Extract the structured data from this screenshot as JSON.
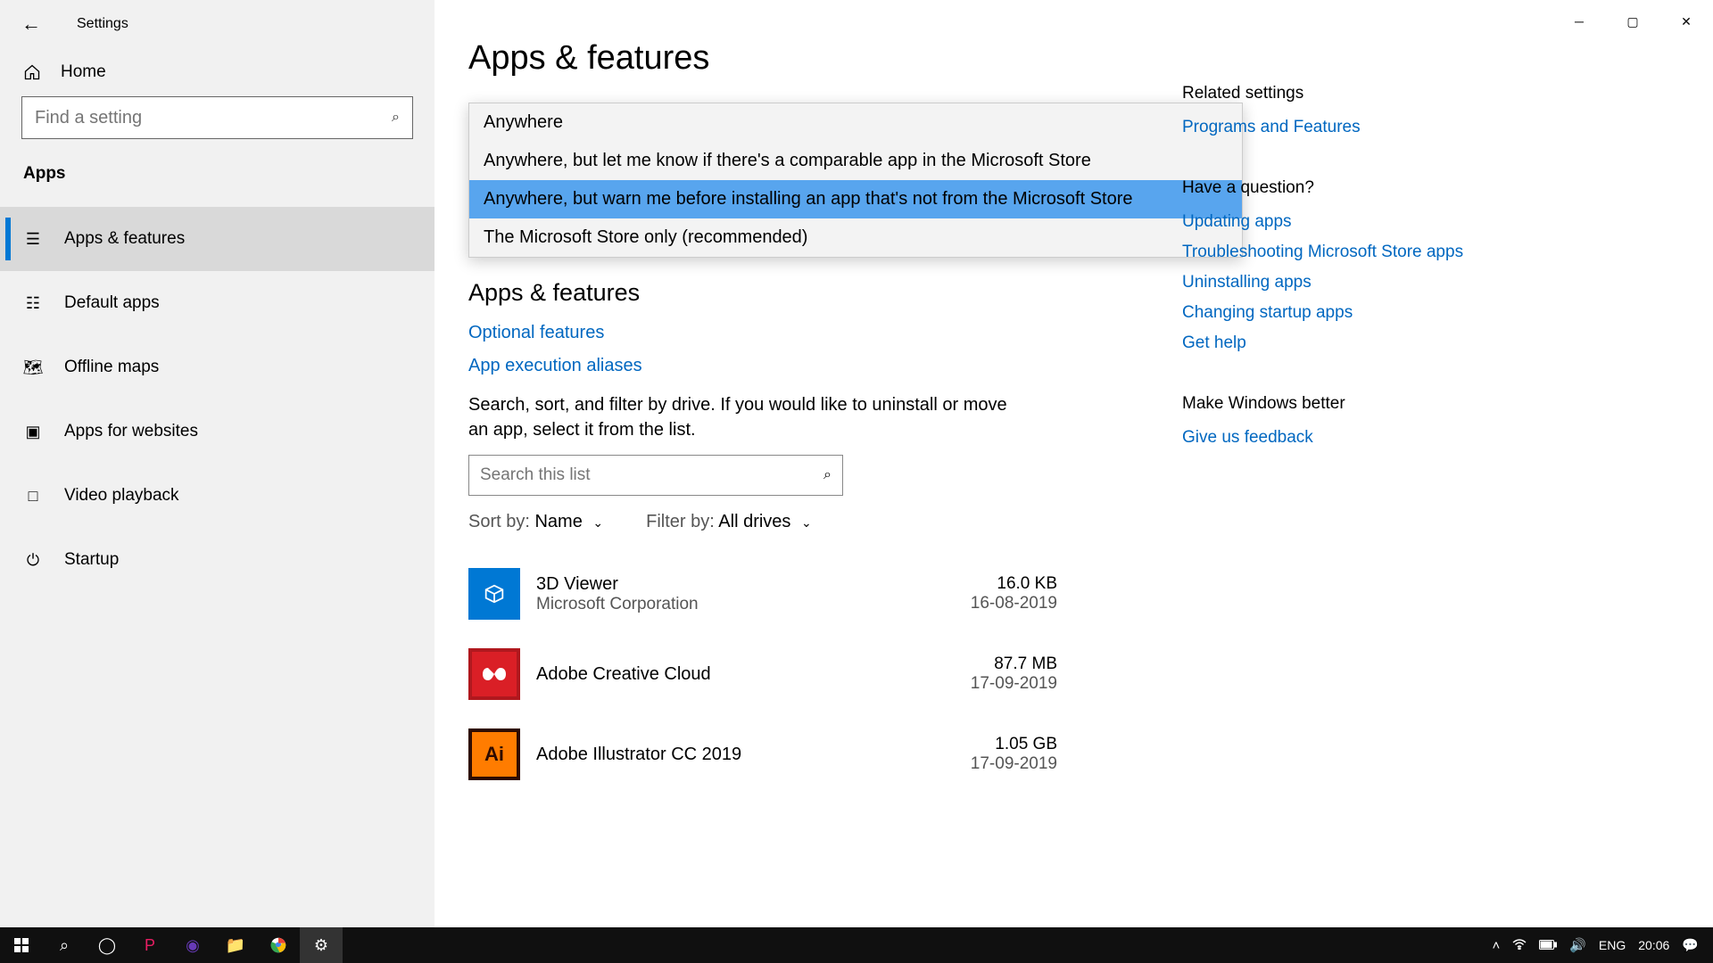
{
  "window": {
    "title": "Settings"
  },
  "sidebar": {
    "home": "Home",
    "search_placeholder": "Find a setting",
    "section": "Apps",
    "items": [
      {
        "label": "Apps & features"
      },
      {
        "label": "Default apps"
      },
      {
        "label": "Offline maps"
      },
      {
        "label": "Apps for websites"
      },
      {
        "label": "Video playback"
      },
      {
        "label": "Startup"
      }
    ]
  },
  "main": {
    "title": "Apps & features",
    "dropdown": [
      "Anywhere",
      "Anywhere, but let me know if there's a comparable app in the Microsoft Store",
      "Anywhere, but warn me before installing an app that's not from the Microsoft Store",
      "The Microsoft Store only (recommended)"
    ],
    "subtitle": "Apps & features",
    "link_optional": "Optional features",
    "link_aliases": "App execution aliases",
    "desc": "Search, sort, and filter by drive. If you would like to uninstall or move an app, select it from the list.",
    "search_placeholder": "Search this list",
    "sort_label": "Sort by:",
    "sort_value": "Name",
    "filter_label": "Filter by:",
    "filter_value": "All drives",
    "apps": [
      {
        "name": "3D Viewer",
        "publisher": "Microsoft Corporation",
        "size": "16.0 KB",
        "date": "16-08-2019",
        "bg": "#0078d4",
        "icon": "⬚"
      },
      {
        "name": "Adobe Creative Cloud",
        "publisher": "",
        "size": "87.7 MB",
        "date": "17-09-2019",
        "bg": "#c4352a",
        "icon": "∞"
      },
      {
        "name": "Adobe Illustrator CC 2019",
        "publisher": "",
        "size": "1.05 GB",
        "date": "17-09-2019",
        "bg": "#310000",
        "icon": "Ai"
      }
    ]
  },
  "right": {
    "related_title": "Related settings",
    "related_links": [
      "Programs and Features"
    ],
    "question_title": "Have a question?",
    "question_links": [
      "Updating apps",
      "Troubleshooting Microsoft Store apps",
      "Uninstalling apps",
      "Changing startup apps",
      "Get help"
    ],
    "feedback_title": "Make Windows better",
    "feedback_link": "Give us feedback"
  },
  "taskbar": {
    "lang": "ENG",
    "time": "20:06"
  }
}
